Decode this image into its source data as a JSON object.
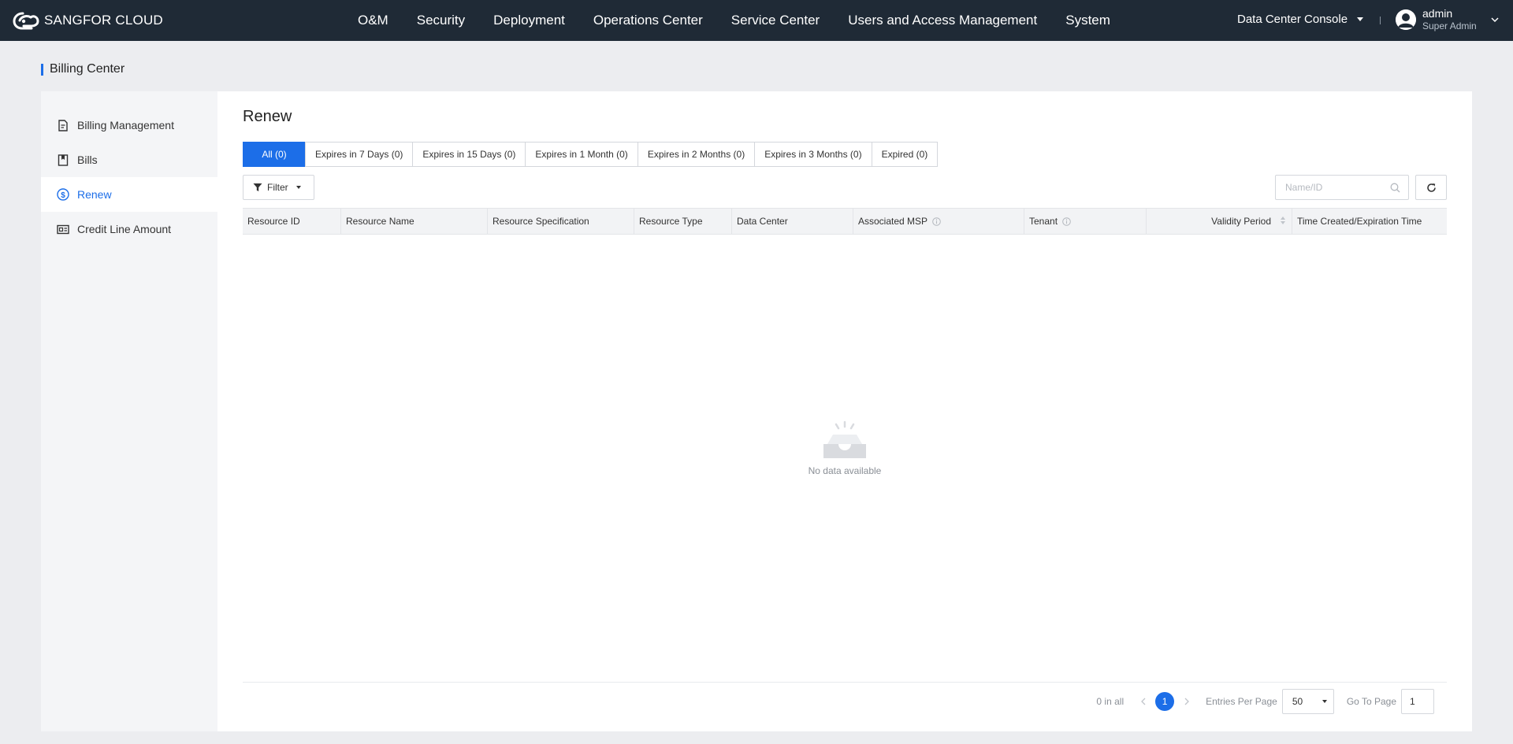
{
  "brand": {
    "name": "SANGFOR CLOUD",
    "logo_icon": "sangfor-cloud-logo"
  },
  "nav": [
    "O&M",
    "Security",
    "Deployment",
    "Operations Center",
    "Service Center",
    "Users and Access Management",
    "System"
  ],
  "header": {
    "console": "Data Center Console",
    "user_name": "admin",
    "user_role": "Super Admin"
  },
  "page": {
    "heading": "Billing Center",
    "title": "Renew"
  },
  "sidebar": {
    "items": [
      {
        "label": "Billing Management",
        "icon": "billing-doc-icon"
      },
      {
        "label": "Bills",
        "icon": "bills-book-icon"
      },
      {
        "label": "Renew",
        "icon": "dollar-circle-icon",
        "active": true
      },
      {
        "label": "Credit Line Amount",
        "icon": "credit-card-icon"
      }
    ]
  },
  "tabs": [
    "All (0)",
    "Expires in 7 Days (0)",
    "Expires in 15 Days (0)",
    "Expires in 1 Month (0)",
    "Expires in 2 Months (0)",
    "Expires in 3 Months (0)",
    "Expired (0)"
  ],
  "toolbar": {
    "filter_label": "Filter",
    "search_placeholder": "Name/ID"
  },
  "table": {
    "columns": [
      "Resource ID",
      "Resource Name",
      "Resource Specification",
      "Resource Type",
      "Data Center",
      "Associated MSP",
      "Tenant",
      "Validity Period",
      "Time Created/Expiration Time"
    ],
    "rows": [],
    "empty_text": "No data available"
  },
  "pagination": {
    "total": "0 in all",
    "current_page": "1",
    "entries_label": "Entries Per Page",
    "entries_value": "50",
    "goto_label": "Go To Page",
    "goto_value": "1"
  },
  "colors": {
    "accent": "#1c6ee8",
    "topbar": "#1f2a36",
    "background": "#ecedf0"
  }
}
